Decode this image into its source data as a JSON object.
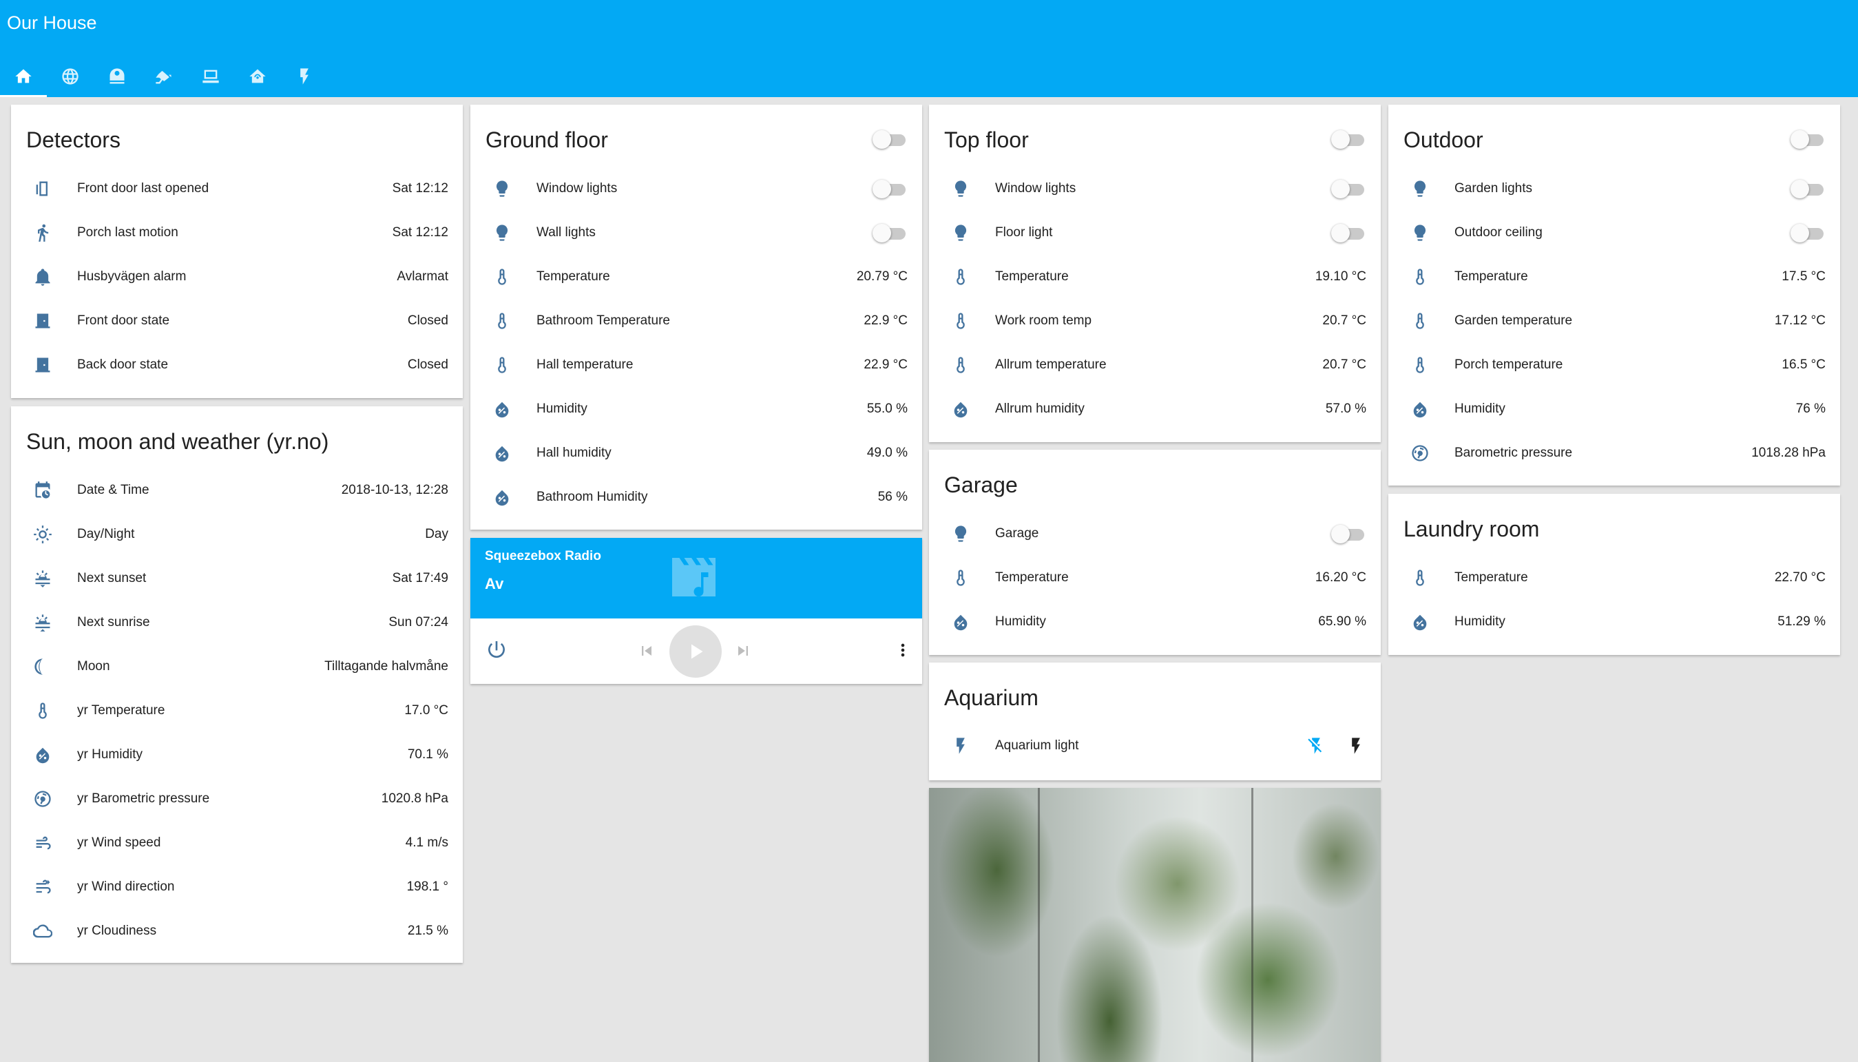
{
  "app": {
    "title": "Our House"
  },
  "tabs": [
    {
      "icon": "home-icon"
    },
    {
      "icon": "globe-icon"
    },
    {
      "icon": "robot-vacuum-icon"
    },
    {
      "icon": "cctv-icon"
    },
    {
      "icon": "laptop-icon"
    },
    {
      "icon": "home-automation-icon"
    },
    {
      "icon": "flash-icon"
    }
  ],
  "detectors": {
    "title": "Detectors",
    "rows": [
      {
        "label": "Front door last opened",
        "value": "Sat 12:12",
        "icon": "door-sensor-icon"
      },
      {
        "label": "Porch last motion",
        "value": "Sat 12:12",
        "icon": "walk-icon"
      },
      {
        "label": "Husbyvägen alarm",
        "value": "Avlarmat",
        "icon": "bell-icon"
      },
      {
        "label": "Front door state",
        "value": "Closed",
        "icon": "door-closed-icon"
      },
      {
        "label": "Back door state",
        "value": "Closed",
        "icon": "door-closed-icon"
      }
    ]
  },
  "weather": {
    "title": "Sun, moon and weather (yr.no)",
    "rows": [
      {
        "label": "Date & Time",
        "value": "2018-10-13, 12:28",
        "icon": "calendar-clock-icon"
      },
      {
        "label": "Day/Night",
        "value": "Day",
        "icon": "sun-icon"
      },
      {
        "label": "Next sunset",
        "value": "Sat 17:49",
        "icon": "sunset-icon"
      },
      {
        "label": "Next sunrise",
        "value": "Sun 07:24",
        "icon": "sunrise-icon"
      },
      {
        "label": "Moon",
        "value": "Tilltagande halvmåne",
        "icon": "moon-icon"
      },
      {
        "label": "yr Temperature",
        "value": "17.0 °C",
        "icon": "thermometer-icon"
      },
      {
        "label": "yr Humidity",
        "value": "70.1 %",
        "icon": "water-percent-icon"
      },
      {
        "label": "yr Barometric pressure",
        "value": "1020.8 hPa",
        "icon": "gauge-icon"
      },
      {
        "label": "yr Wind speed",
        "value": "4.1 m/s",
        "icon": "wind-icon"
      },
      {
        "label": "yr Wind direction",
        "value": "198.1 °",
        "icon": "wind-direction-icon"
      },
      {
        "label": "yr Cloudiness",
        "value": "21.5 %",
        "icon": "cloud-icon"
      }
    ]
  },
  "ground_floor": {
    "title": "Ground floor",
    "header_toggle_on": false,
    "rows": [
      {
        "label": "Window lights",
        "toggle": true,
        "on": false,
        "icon": "lightbulb-icon"
      },
      {
        "label": "Wall lights",
        "toggle": true,
        "on": false,
        "icon": "lightbulb-icon"
      },
      {
        "label": "Temperature",
        "value": "20.79 °C",
        "icon": "thermometer-icon"
      },
      {
        "label": "Bathroom Temperature",
        "value": "22.9 °C",
        "icon": "thermometer-icon"
      },
      {
        "label": "Hall temperature",
        "value": "22.9 °C",
        "icon": "thermometer-icon"
      },
      {
        "label": "Humidity",
        "value": "55.0 %",
        "icon": "water-percent-icon"
      },
      {
        "label": "Hall humidity",
        "value": "49.0 %",
        "icon": "water-percent-icon"
      },
      {
        "label": "Bathroom Humidity",
        "value": "56 %",
        "icon": "water-percent-icon"
      }
    ]
  },
  "media_player": {
    "name": "Squeezebox Radio",
    "state": "Av",
    "art_icon": "movie-music-icon"
  },
  "top_floor": {
    "title": "Top floor",
    "header_toggle_on": false,
    "rows": [
      {
        "label": "Window lights",
        "toggle": true,
        "on": false,
        "icon": "lightbulb-icon"
      },
      {
        "label": "Floor light",
        "toggle": true,
        "on": false,
        "icon": "lightbulb-icon"
      },
      {
        "label": "Temperature",
        "value": "19.10 °C",
        "icon": "thermometer-icon"
      },
      {
        "label": "Work room temp",
        "value": "20.7 °C",
        "icon": "thermometer-icon"
      },
      {
        "label": "Allrum temperature",
        "value": "20.7 °C",
        "icon": "thermometer-icon"
      },
      {
        "label": "Allrum humidity",
        "value": "57.0 %",
        "icon": "water-percent-icon"
      }
    ]
  },
  "garage": {
    "title": "Garage",
    "rows": [
      {
        "label": "Garage",
        "toggle": true,
        "on": false,
        "icon": "lightbulb-icon"
      },
      {
        "label": "Temperature",
        "value": "16.20 °C",
        "icon": "thermometer-icon"
      },
      {
        "label": "Humidity",
        "value": "65.90 %",
        "icon": "water-percent-icon"
      }
    ]
  },
  "aquarium": {
    "title": "Aquarium",
    "rows": [
      {
        "label": "Aquarium light",
        "icon": "flash-icon"
      }
    ]
  },
  "outdoor": {
    "title": "Outdoor",
    "header_toggle_on": false,
    "rows": [
      {
        "label": "Garden lights",
        "toggle": true,
        "on": false,
        "icon": "lightbulb-icon"
      },
      {
        "label": "Outdoor ceiling",
        "toggle": true,
        "on": false,
        "icon": "lightbulb-icon"
      },
      {
        "label": "Temperature",
        "value": "17.5 °C",
        "icon": "thermometer-icon"
      },
      {
        "label": "Garden temperature",
        "value": "17.12 °C",
        "icon": "thermometer-icon"
      },
      {
        "label": "Porch temperature",
        "value": "16.5 °C",
        "icon": "thermometer-icon"
      },
      {
        "label": "Humidity",
        "value": "76 %",
        "icon": "water-percent-icon"
      },
      {
        "label": "Barometric pressure",
        "value": "1018.28 hPa",
        "icon": "gauge-icon"
      }
    ]
  },
  "laundry": {
    "title": "Laundry room",
    "rows": [
      {
        "label": "Temperature",
        "value": "22.70 °C",
        "icon": "thermometer-icon"
      },
      {
        "label": "Humidity",
        "value": "51.29 %",
        "icon": "water-percent-icon"
      }
    ]
  },
  "colors": {
    "accent": "#03a9f4",
    "icon": "#44739e",
    "background": "#e5e5e5"
  }
}
